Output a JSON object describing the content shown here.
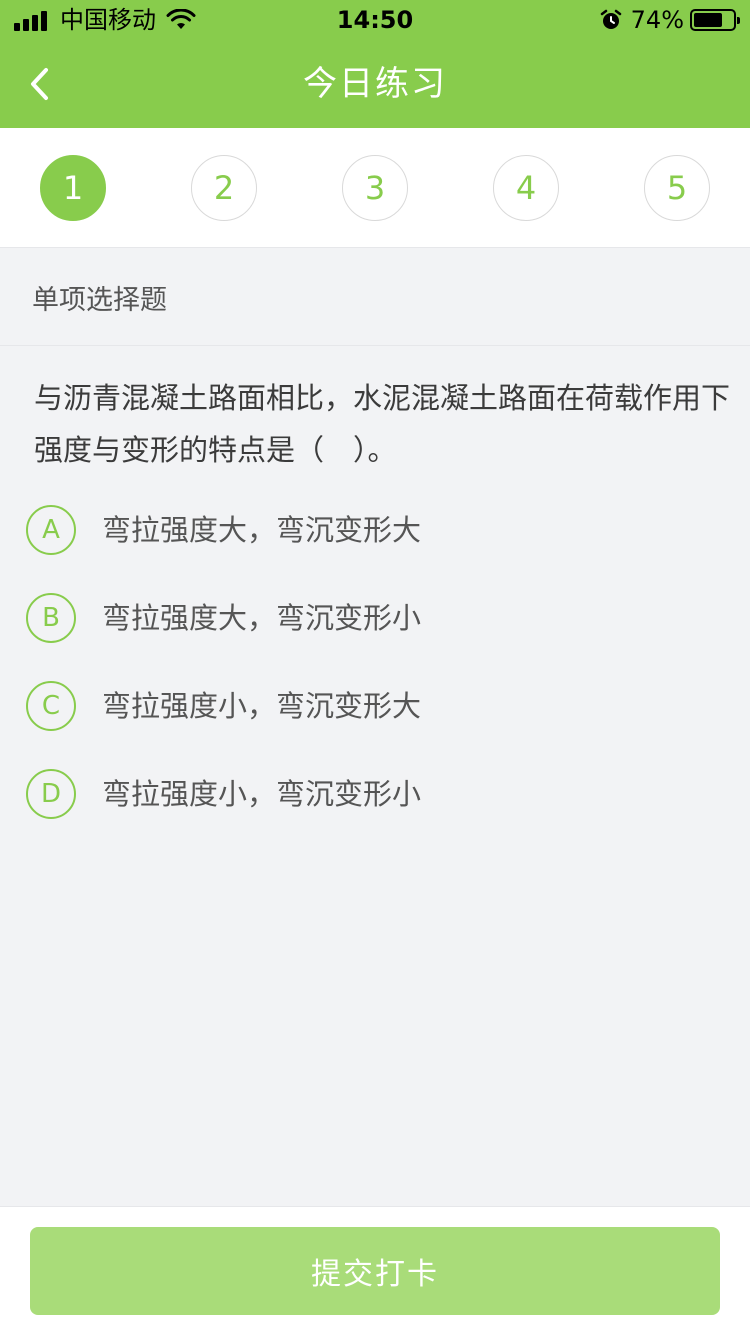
{
  "status_bar": {
    "carrier": "中国移动",
    "time": "14:50",
    "battery_percent": "74%",
    "battery_level": 0.74
  },
  "nav": {
    "title": "今日练习",
    "back_icon": "chevron-left-icon"
  },
  "steps": {
    "items": [
      "1",
      "2",
      "3",
      "4",
      "5"
    ],
    "active_index": 0
  },
  "question": {
    "type_label": "单项选择题",
    "text": "与沥青混凝土路面相比，水泥混凝土路面在荷载作用下强度与变形的特点是（　）。",
    "options": [
      {
        "letter": "A",
        "text": "弯拉强度大，弯沉变形大"
      },
      {
        "letter": "B",
        "text": "弯拉强度大，弯沉变形小"
      },
      {
        "letter": "C",
        "text": "弯拉强度小，弯沉变形大"
      },
      {
        "letter": "D",
        "text": "弯拉强度小，弯沉变形小"
      }
    ]
  },
  "footer": {
    "submit_label": "提交打卡"
  },
  "colors": {
    "accent": "#88cc4c",
    "accent_light": "#a9dc79",
    "background": "#f2f3f5"
  }
}
